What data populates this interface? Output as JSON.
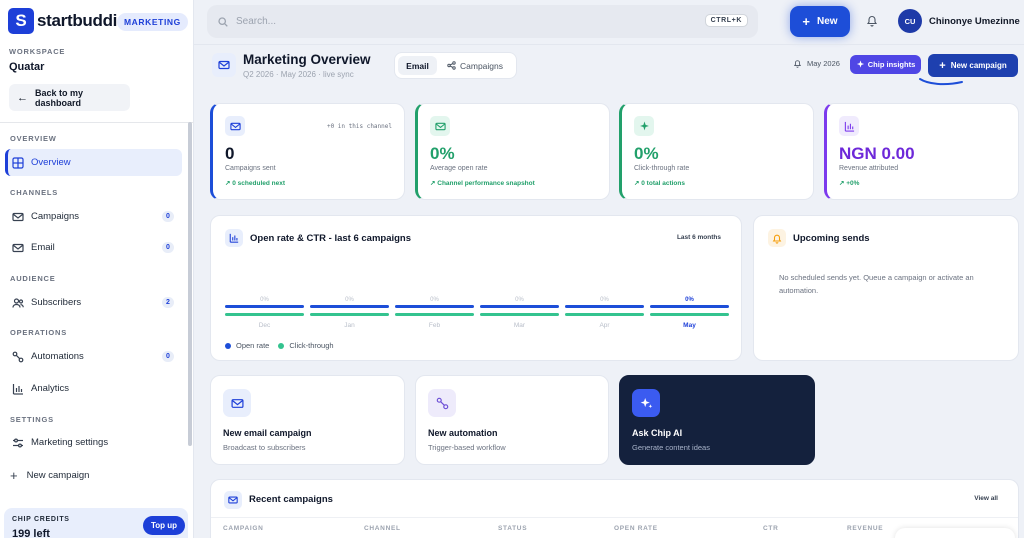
{
  "brand": {
    "logo_letter": "S",
    "name": "startbuddi",
    "badge": "MARKETING"
  },
  "workspace": {
    "label": "WORKSPACE",
    "name": "Quatar"
  },
  "back_label": "Back to my dashboard",
  "sidebar": {
    "sections": [
      "OVERVIEW",
      "CHANNELS",
      "AUDIENCE",
      "OPERATIONS",
      "SETTINGS"
    ],
    "items": [
      {
        "label": "Overview",
        "icon": "grid-icon",
        "active": true
      },
      {
        "label": "Campaigns",
        "icon": "mail-icon",
        "count": "0"
      },
      {
        "label": "Email",
        "icon": "mail-icon",
        "count": "0"
      },
      {
        "label": "Subscribers",
        "icon": "users-icon",
        "count": "2"
      },
      {
        "label": "Automations",
        "icon": "workflow-icon",
        "count": "0"
      },
      {
        "label": "Analytics",
        "icon": "bar-chart-icon"
      },
      {
        "label": "Marketing settings",
        "icon": "sliders-icon"
      }
    ],
    "new_campaign": "New campaign"
  },
  "credits": {
    "label": "CHIP CREDITS",
    "value": "199 left",
    "topup": "Top up"
  },
  "topbar": {
    "search_placeholder": "Search...",
    "shortcut": "CTRL+K",
    "new_label": "New",
    "user_initials": "CU",
    "user_name": "Chinonye Umezinne"
  },
  "page": {
    "title": "Marketing Overview",
    "subtitle": "Q2 2026 · May 2026 · live sync",
    "tabs": [
      "Email",
      "Campaigns"
    ],
    "date": "May 2026",
    "insights_label": "Chip insights",
    "new_campaign_label": "New campaign"
  },
  "stats": [
    {
      "value": "0",
      "label": "Campaigns sent",
      "trend": "0 scheduled next",
      "note": "+0 in this channel",
      "color": "#0f172a"
    },
    {
      "value": "0%",
      "label": "Average open rate",
      "trend": "Channel performance snapshot",
      "color": "#22a06b"
    },
    {
      "value": "0%",
      "label": "Click-through rate",
      "trend": "0 total actions",
      "color": "#22a06b"
    },
    {
      "value": "NGN 0.00",
      "label": "Revenue attributed",
      "trend": "+0%",
      "color": "#6d28d9"
    }
  ],
  "chart_card": {
    "title": "Open rate & CTR - last 6 campaigns",
    "range": "Last 6 months"
  },
  "chart_data": {
    "type": "bar",
    "categories": [
      "Dec",
      "Jan",
      "Feb",
      "Mar",
      "Apr",
      "May"
    ],
    "series": [
      {
        "name": "Open rate",
        "values": [
          0,
          0,
          0,
          0,
          0,
          0
        ],
        "color": "#1d4ed8"
      },
      {
        "name": "Click-through",
        "values": [
          0,
          0,
          0,
          0,
          0,
          0
        ],
        "color": "#34c38f"
      }
    ],
    "data_labels": [
      "0%",
      "0%",
      "0%",
      "0%",
      "0%",
      "0%"
    ],
    "highlight_category": "May"
  },
  "upcoming": {
    "title": "Upcoming sends",
    "text": "No scheduled sends yet. Queue a campaign or activate an automation."
  },
  "actions": [
    {
      "title": "New email campaign",
      "sub": "Broadcast to subscribers"
    },
    {
      "title": "New automation",
      "sub": "Trigger-based workflow"
    },
    {
      "title": "Ask Chip AI",
      "sub": "Generate content ideas"
    }
  ],
  "recent": {
    "title": "Recent campaigns",
    "view_all": "View all",
    "columns": [
      "CAMPAIGN",
      "CHANNEL",
      "STATUS",
      "OPEN RATE",
      "CTR",
      "REVENUE"
    ]
  }
}
